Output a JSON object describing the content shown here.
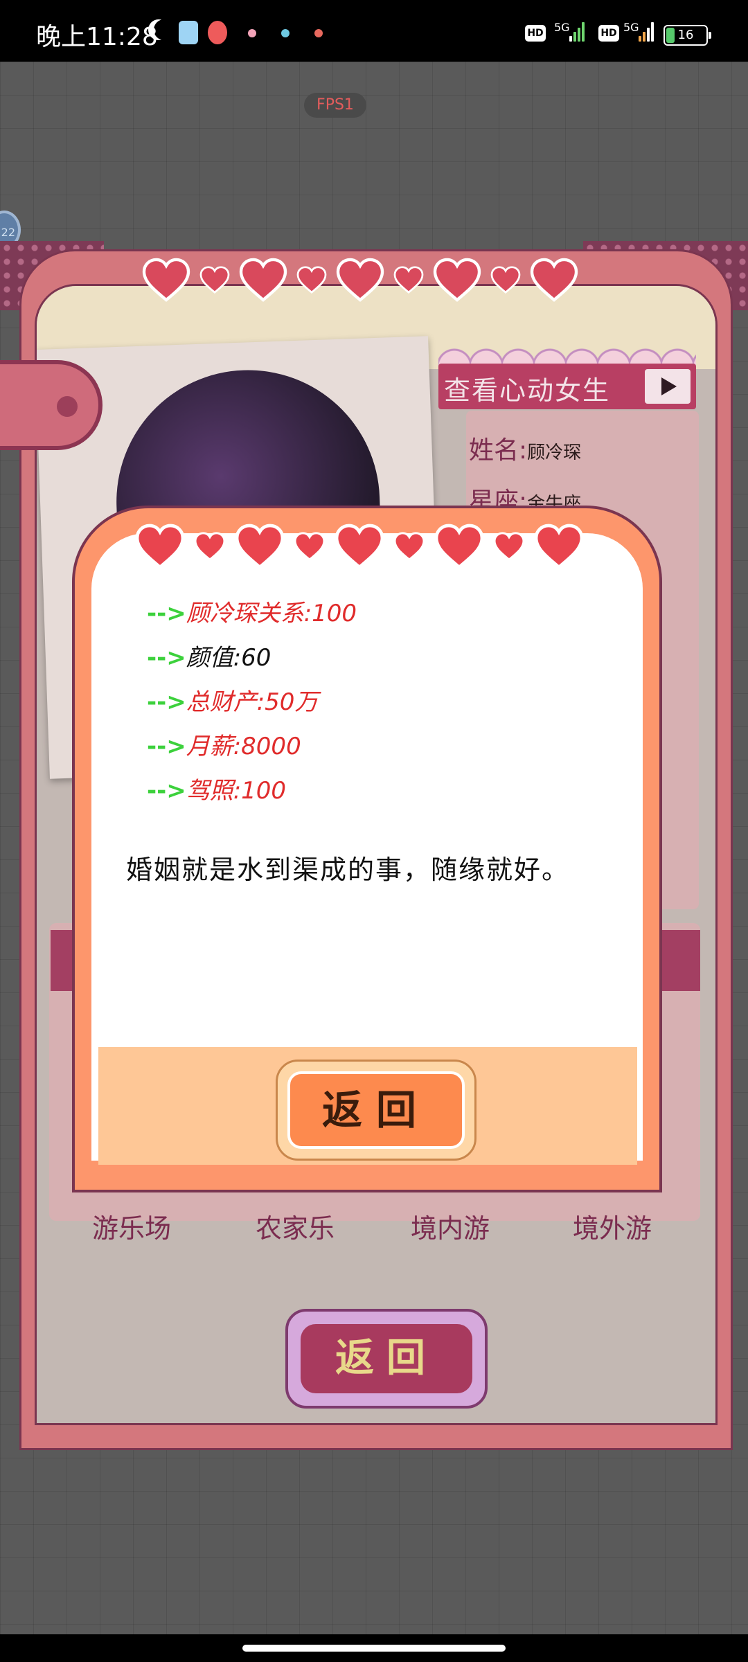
{
  "status_bar": {
    "time": "晚上11:28",
    "network1": "5G",
    "network2": "5G",
    "hd1": "HD",
    "hd2": "HD",
    "battery": "16"
  },
  "fps_label": "FPS1",
  "side_badge": "22",
  "background_screen": {
    "title": "查看心动女生",
    "name_label": "姓名:",
    "name_value": "顾冷琛",
    "zodiac_label": "星座:",
    "zodiac_value": "金牛座",
    "categories": [
      "游乐场",
      "农家乐",
      "境内游",
      "境外游"
    ],
    "back_button": "返回"
  },
  "modal": {
    "stats": [
      {
        "arrow": "-->",
        "text": "顾冷琛关系:100",
        "color": "#e02b2b"
      },
      {
        "arrow": "-->",
        "text": "颜值:60",
        "color": "#111111"
      },
      {
        "arrow": "-->",
        "text": "总财产:50万",
        "color": "#e02b2b"
      },
      {
        "arrow": "-->",
        "text": "月薪:8000",
        "color": "#e02b2b"
      },
      {
        "arrow": "-->",
        "text": "驾照:100",
        "color": "#e02b2b"
      }
    ],
    "quote": "婚姻就是水到渠成的事，随缘就好。",
    "back_button": "返回"
  },
  "colors": {
    "heart": "#e9444e",
    "modal_orange": "#fd966c",
    "footer_peach": "#fec796",
    "card_pink": "#d4777d",
    "accent_magenta": "#a83a5e"
  }
}
